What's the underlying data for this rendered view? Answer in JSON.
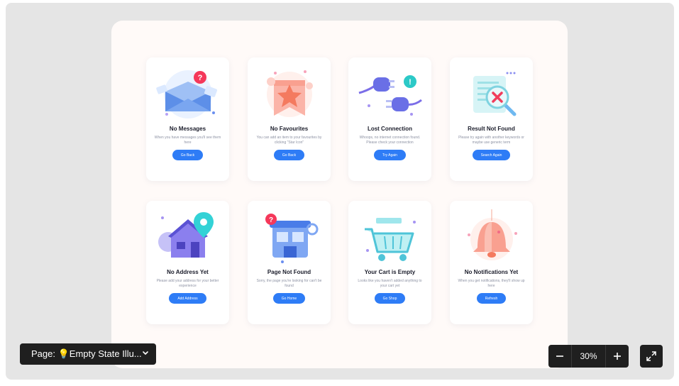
{
  "cards": [
    {
      "title": "No Messages",
      "desc": "When you have messages you'll see them here",
      "button": "Go Back",
      "icon": "envelope-question-icon"
    },
    {
      "title": "No Favourites",
      "desc": "You can add an item to your favourites by clicking \"Star Icon\"",
      "button": "Go Back",
      "icon": "star-ribbon-icon"
    },
    {
      "title": "Lost Connection",
      "desc": "Whoops, no internet connection found. Please check your connection",
      "button": "Try Again",
      "icon": "unplugged-icon"
    },
    {
      "title": "Result Not Found",
      "desc": "Please try again with another keywords or maybe use generic term",
      "button": "Search Again",
      "icon": "magnifier-x-icon"
    },
    {
      "title": "No Address Yet",
      "desc": "Please add your address for your better experience",
      "button": "Add Address",
      "icon": "house-pin-icon"
    },
    {
      "title": "Page Not Found",
      "desc": "Sorry, the page you're looking for can't be found",
      "button": "Go Home",
      "icon": "store-question-icon"
    },
    {
      "title": "Your Cart is Empty",
      "desc": "Looks like you haven't added anything to your cart yet",
      "button": "Go Shop",
      "icon": "shopping-cart-icon"
    },
    {
      "title": "No Notifications Yet",
      "desc": "When you get notifications, they'll show up here",
      "button": "Refresh",
      "icon": "bell-icon"
    }
  ],
  "page_selector": {
    "label": "Page: 💡Empty State Illu...",
    "icon": "chevron-down-icon"
  },
  "zoom": {
    "value": "30%",
    "minus_icon": "minus-icon",
    "plus_icon": "plus-icon"
  },
  "fullscreen": {
    "icon": "expand-icon"
  },
  "colors": {
    "accent": "#2e7cf6",
    "canvas": "#e5e5e5",
    "artboard": "#fffaf8",
    "toolbar": "#1f1f1f"
  }
}
